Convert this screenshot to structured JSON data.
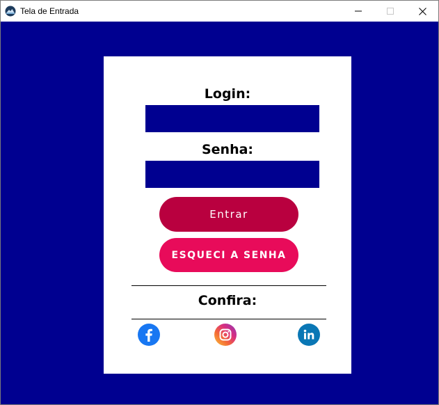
{
  "window": {
    "title": "Tela de Entrada"
  },
  "form": {
    "login_label": "Login:",
    "login_value": "",
    "password_label": "Senha:",
    "password_value": "",
    "login_button": "Entrar",
    "forgot_button": "ESQUECI A SENHA",
    "confira_label": "Confira:"
  },
  "social": [
    {
      "name": "facebook",
      "icon": "facebook-icon"
    },
    {
      "name": "instagram",
      "icon": "instagram-icon"
    },
    {
      "name": "linkedin",
      "icon": "linkedin-icon"
    }
  ],
  "colors": {
    "background": "#000090",
    "field": "#000090",
    "entrar_button": "#b9003f",
    "esqueci_button": "#e80b5a",
    "facebook": "#1877f2",
    "linkedin": "#0a77b5"
  }
}
